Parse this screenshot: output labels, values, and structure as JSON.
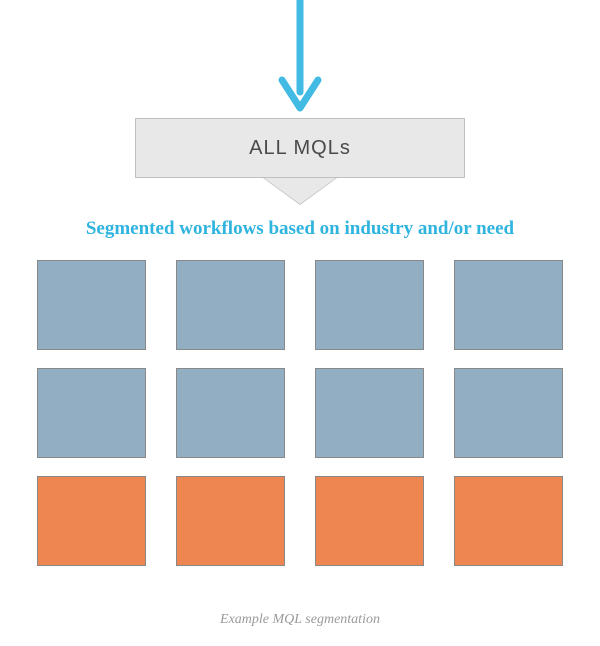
{
  "arrow": {
    "color": "#41bbe4"
  },
  "box": {
    "label": "ALL MQLs"
  },
  "subtitle": "Segmented workflows based on industry and/or need",
  "grid": {
    "rows": 3,
    "cols": 4,
    "colors": {
      "blue": "#92aec3",
      "orange": "#ed8650"
    },
    "row_colors": [
      "blue",
      "blue",
      "orange"
    ]
  },
  "caption": "Example MQL segmentation"
}
